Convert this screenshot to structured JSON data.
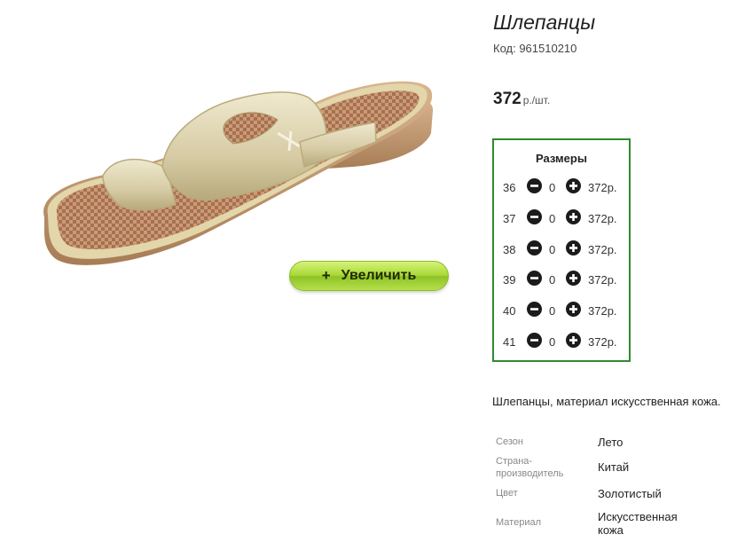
{
  "product": {
    "title": "Шлепанцы",
    "sku_label": "Код: 961510210",
    "price": {
      "amount": "372",
      "unit": "р./шт."
    }
  },
  "zoom_button": {
    "icon": "+",
    "label": "Увеличить"
  },
  "sizes": {
    "title": "Размеры",
    "rows": [
      {
        "size": "36",
        "qty": "0",
        "price": "372р."
      },
      {
        "size": "37",
        "qty": "0",
        "price": "372р."
      },
      {
        "size": "38",
        "qty": "0",
        "price": "372р."
      },
      {
        "size": "39",
        "qty": "0",
        "price": "372р."
      },
      {
        "size": "40",
        "qty": "0",
        "price": "372р."
      },
      {
        "size": "41",
        "qty": "0",
        "price": "372р."
      }
    ]
  },
  "description": "Шлепанцы, материал искусственная кожа.",
  "specs": [
    {
      "key": "Сезон",
      "value": "Лето"
    },
    {
      "key": "Страна-производитель",
      "value": "Китай"
    },
    {
      "key": "Цвет",
      "value": "Золотистый"
    },
    {
      "key": "Материал",
      "value": "Искусственная кожа"
    }
  ],
  "colors": {
    "accent_border": "#2f8a2f",
    "button_green": "#a9d836"
  },
  "icons": {
    "minus": "minus-circle-icon",
    "plus": "plus-circle-icon"
  }
}
